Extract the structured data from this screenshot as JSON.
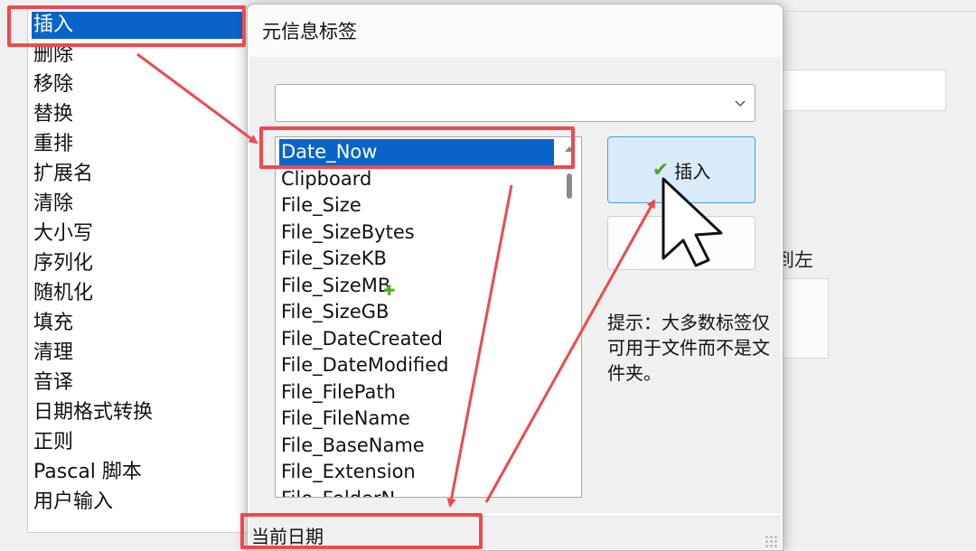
{
  "rule_list": {
    "items": [
      "插入",
      "删除",
      "移除",
      "替换",
      "重排",
      "扩展名",
      "清除",
      "大小写",
      "序列化",
      "随机化",
      "填充",
      "清理",
      "音译",
      "日期格式转换",
      "正则",
      "Pascal 脚本",
      "用户输入"
    ],
    "selected_index": 0
  },
  "background": {
    "partial_label": "到左"
  },
  "dialog": {
    "title": "元信息标签",
    "combo_value": "",
    "tags": [
      "Date_Now",
      "Clipboard",
      "File_Size",
      "File_SizeBytes",
      "File_SizeKB",
      "File_SizeMB",
      "File_SizeGB",
      "File_DateCreated",
      "File_DateModified",
      "File_FilePath",
      "File_FileName",
      "File_BaseName",
      "File_Extension",
      "File_FolderN"
    ],
    "selected_tag_index": 0,
    "insert_label": "插入",
    "hint": "提示：大多数标签仅可用于文件而不是文件夹。",
    "status_text": "当前日期"
  },
  "colors": {
    "selection": "#0a64c8",
    "annotation": "#f0484e",
    "check": "#5aa11c"
  },
  "icons": {
    "combo": "chevron-down-icon",
    "insert": "checkmark-icon",
    "cursor": "mouse-pointer-icon"
  }
}
